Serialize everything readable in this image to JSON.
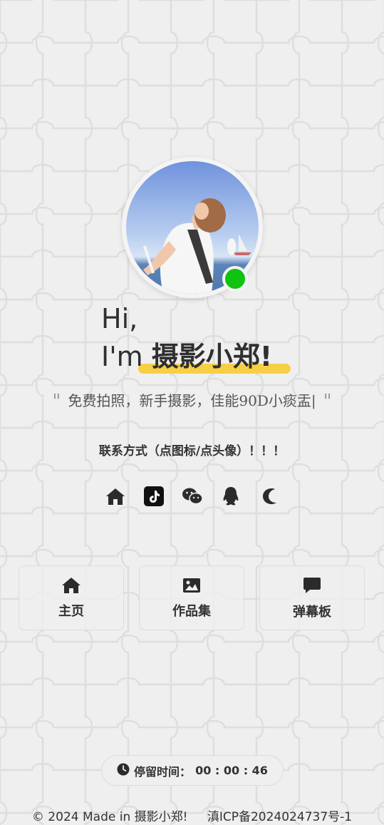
{
  "profile": {
    "greeting_line1": "Hi,",
    "greeting_prefix": "I'm",
    "name": "摄影小郑!",
    "status_color": "#10c30f",
    "highlight_color": "#f7cf45"
  },
  "tagline": {
    "open_quote": "\"",
    "text": "免费拍照，新手摄影，佳能90D小痰盂|",
    "close_quote": "\""
  },
  "contact": {
    "title": "联系方式（点图标/点头像）！！！",
    "icons": [
      "home-icon",
      "tiktok-icon",
      "wechat-icon",
      "qq-icon",
      "moon-icon"
    ]
  },
  "nav": [
    {
      "label": "主页",
      "icon": "home-icon"
    },
    {
      "label": "作品集",
      "icon": "image-icon"
    },
    {
      "label": "弹幕板",
      "icon": "comment-icon"
    }
  ],
  "timer": {
    "label": "停留时间：",
    "value": "00 : 00 : 46"
  },
  "footer": {
    "copyright": "© 2024 Made in 摄影小郑!",
    "icp": "滇ICP备2024024737号-1"
  }
}
